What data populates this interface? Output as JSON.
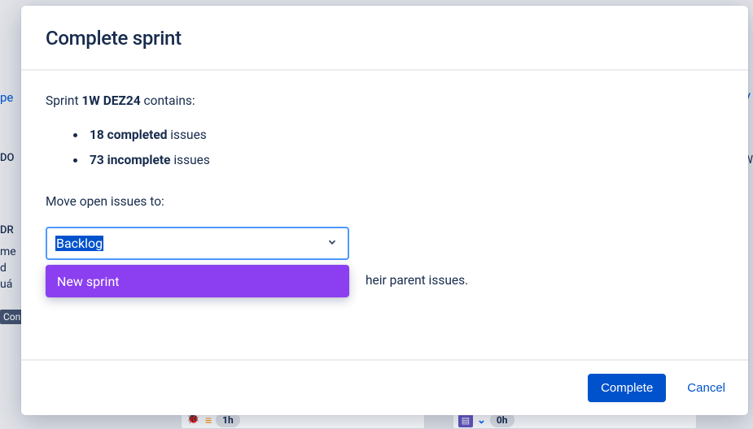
{
  "dialog": {
    "title": "Complete sprint",
    "sprint_prefix": "Sprint ",
    "sprint_name": "1W DEZ24",
    "sprint_suffix": " contains:",
    "completed_count": "18 completed",
    "completed_suffix": " issues",
    "incomplete_count": "73 incomplete",
    "incomplete_suffix": " issues",
    "move_label": "Move open issues to:",
    "select_value": "Backlog",
    "dropdown_option": "New sprint",
    "hint_fragment": "heir parent issues.",
    "complete_label": "Complete",
    "cancel_label": "Cancel"
  },
  "background": {
    "pe": "pe",
    "v": "V",
    "oo": "DO",
    "or": "DR",
    "w": "W",
    "t1": "me",
    "t2": "d",
    "t3": "uá",
    "con": "Con",
    "h1": "1h",
    "h0": "0h"
  }
}
